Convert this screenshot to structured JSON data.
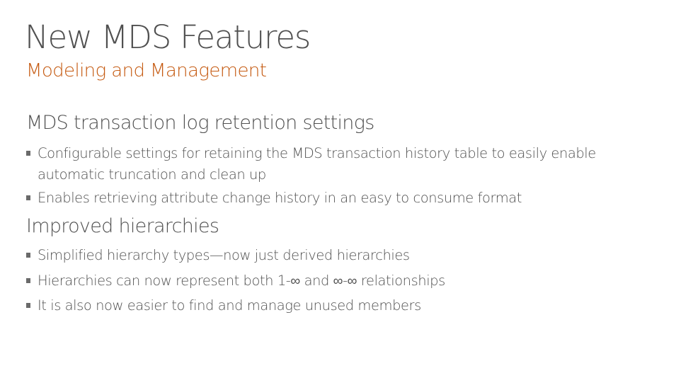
{
  "slide": {
    "title": "New MDS Features",
    "subtitle": "Modeling and Management",
    "accent_color": "#c55a11",
    "sections": [
      {
        "heading": "MDS transaction log retention settings",
        "bullets": [
          "Configurable settings for retaining the MDS transaction history table to easily enable automatic truncation and clean up",
          "Enables retrieving attribute change history in an easy to consume format"
        ]
      },
      {
        "heading": "Improved hierarchies",
        "bullets": [
          "Simplified hierarchy types—now just derived hierarchies",
          "Hierarchies can now represent both 1-∞ and ∞-∞ relationships",
          "It is also now easier to find and manage unused members"
        ]
      }
    ],
    "bullet_icon": "square-bullet-icon"
  }
}
